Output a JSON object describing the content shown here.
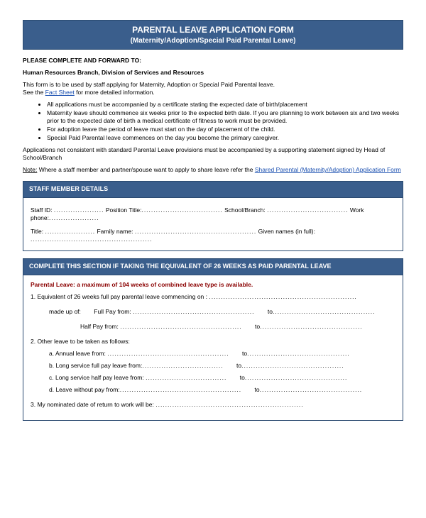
{
  "banner": {
    "title": "PARENTAL LEAVE APPLICATION FORM",
    "subtitle": "(Maternity/Adoption/Special Paid Parental Leave)"
  },
  "intro": {
    "complete_heading": "PLEASE COMPLETE AND FORWARD TO:",
    "complete_to": "Human Resources Branch, Division of Services and Resources",
    "usage_pre": "This form is to be used by staff applying for Maternity, Adoption or Special Paid Parental leave.",
    "see_pre": "See the ",
    "fact_sheet_link": "Fact Sheet",
    "see_post": " for more detailed information.",
    "bullets": [
      "All applications must be accompanied by a certificate stating the expected date of birth/placement",
      "Maternity leave should commence six weeks prior to the expected birth date.  If you are planning to work between six and two weeks prior to the expected date of birth a medical certificate of fitness to work must be provided.",
      "For adoption leave the period of leave must start on the day of placement of the child.",
      "Special Paid Parental leave commences on the day you become the primary caregiver."
    ],
    "not_consistent": "Applications not consistent with standard Parental Leave provisions must be accompanied by a supporting statement signed by Head of School/Branch",
    "note_label": "Note:",
    "note_text": " Where a staff member and partner/spouse want to apply to share leave refer the ",
    "shared_link": "Shared Parental (Maternity/Adoption) Application Form"
  },
  "staff_section": {
    "heading": "STAFF MEMBER DETAILS",
    "row1_staff_id": "Staff ID: ",
    "row1_position": " Position Title:",
    "row1_school": "School/Branch: ",
    "row1_workphone": " Work phone:",
    "row2_title": "Title: ",
    "row2_family": " Family name: ",
    "row2_given": "Given names (in full): "
  },
  "leave_section": {
    "heading": "COMPLETE THIS SECTION IF TAKING THE EQUIVALENT OF 26 WEEKS AS PAID PARENTAL LEAVE",
    "red_note": "Parental Leave: a maximum of 104 weeks of combined leave type is available.",
    "item1_label": "1.   Equivalent of 26 weeks full pay parental leave commencing on : ",
    "item1_madeup": "made up of:",
    "item1_fullpay": "Full Pay from:  ",
    "item1_halfpay": "Half Pay from:  ",
    "to_label": "to",
    "item2_label": "2.   Other leave to be taken as follows:",
    "item2_a": "a.   Annual leave from: ",
    "item2_b": "b.   Long service full pay leave from:",
    "item2_c": "c.   Long service half pay leave from: ",
    "item2_d": "d.   Leave without pay from:",
    "item3_label": "3.   My nominated date of return to work will be: "
  },
  "dots": {
    "short": ".....................",
    "med": "..................................",
    "long": "...................................................",
    "xlong": "..............................................................",
    "to_dots": "..........................................."
  }
}
